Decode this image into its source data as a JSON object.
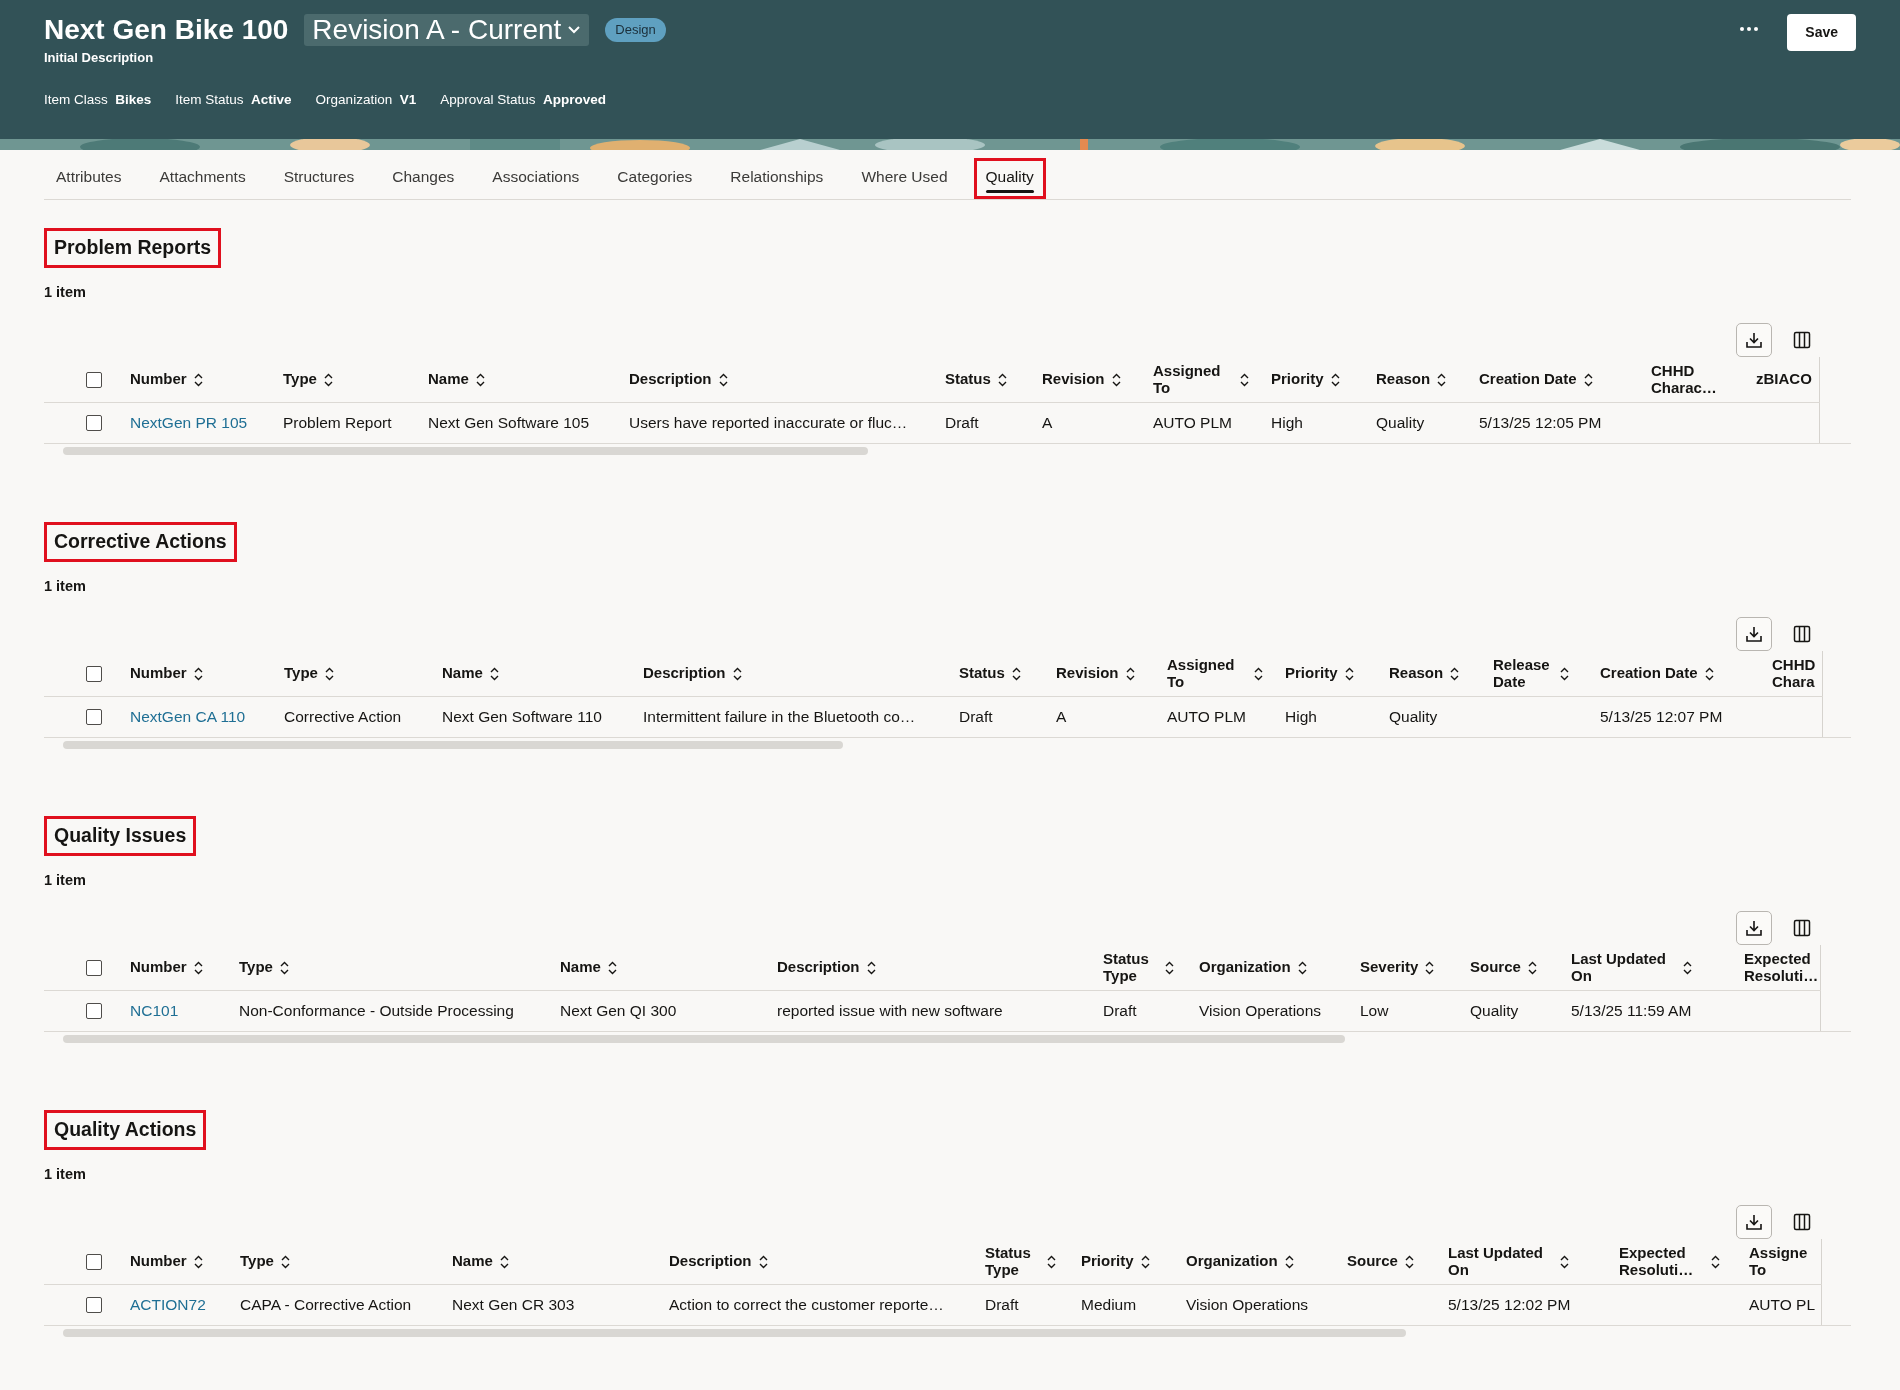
{
  "header": {
    "title": "Next Gen Bike 100",
    "revision": "Revision A - Current",
    "badge": "Design",
    "description": "Initial Description",
    "meta": [
      {
        "label": "Item Class",
        "value": "Bikes"
      },
      {
        "label": "Item Status",
        "value": "Active"
      },
      {
        "label": "Organization",
        "value": "V1"
      },
      {
        "label": "Approval Status",
        "value": "Approved"
      }
    ],
    "save": "Save"
  },
  "tabs": [
    {
      "label": "Attributes",
      "selected": false,
      "highlighted": false
    },
    {
      "label": "Attachments",
      "selected": false,
      "highlighted": false
    },
    {
      "label": "Structures",
      "selected": false,
      "highlighted": false
    },
    {
      "label": "Changes",
      "selected": false,
      "highlighted": false
    },
    {
      "label": "Associations",
      "selected": false,
      "highlighted": false
    },
    {
      "label": "Categories",
      "selected": false,
      "highlighted": false
    },
    {
      "label": "Relationships",
      "selected": false,
      "highlighted": false
    },
    {
      "label": "Where Used",
      "selected": false,
      "highlighted": false
    },
    {
      "label": "Quality",
      "selected": true,
      "highlighted": true
    }
  ],
  "sections": [
    {
      "title": "Problem Reports",
      "highlighted": true,
      "count": "1 item",
      "all_checked": false,
      "columns": [
        {
          "label": "Number",
          "sortable": true
        },
        {
          "label": "Type",
          "sortable": true
        },
        {
          "label": "Name",
          "sortable": true
        },
        {
          "label": "Description",
          "sortable": true
        },
        {
          "label": "Status",
          "sortable": true
        },
        {
          "label": "Revision",
          "sortable": true
        },
        {
          "label": "Assigned To",
          "sortable": true
        },
        {
          "label": "Priority",
          "sortable": true
        },
        {
          "label": "Reason",
          "sortable": true
        },
        {
          "label": "Creation Date",
          "sortable": true
        },
        {
          "label": "CHHD Charac…",
          "sortable": false
        },
        {
          "label": "zBIACO",
          "sortable": false
        }
      ],
      "rows": [
        {
          "checked": false,
          "cells": [
            "NextGen PR 105",
            "Problem Report",
            "Next Gen Software 105",
            "Users have reported inaccurate or fluc…",
            "Draft",
            "A",
            "AUTO PLM",
            "High",
            "Quality",
            "5/13/25 12:05 PM",
            "",
            ""
          ]
        }
      ]
    },
    {
      "title": "Corrective Actions",
      "highlighted": true,
      "count": "1 item",
      "all_checked": false,
      "columns": [
        {
          "label": "Number",
          "sortable": true
        },
        {
          "label": "Type",
          "sortable": true
        },
        {
          "label": "Name",
          "sortable": true
        },
        {
          "label": "Description",
          "sortable": true
        },
        {
          "label": "Status",
          "sortable": true
        },
        {
          "label": "Revision",
          "sortable": true
        },
        {
          "label": "Assigned To",
          "sortable": true
        },
        {
          "label": "Priority",
          "sortable": true
        },
        {
          "label": "Reason",
          "sortable": true
        },
        {
          "label": "Release Date",
          "sortable": true
        },
        {
          "label": "Creation Date",
          "sortable": true
        },
        {
          "label": "CHHD Chara",
          "sortable": false
        }
      ],
      "rows": [
        {
          "checked": false,
          "cells": [
            "NextGen CA 110",
            "Corrective Action",
            "Next Gen Software 110",
            "Intermittent failure in the Bluetooth co…",
            "Draft",
            "A",
            "AUTO PLM",
            "High",
            "Quality",
            "",
            "5/13/25 12:07 PM",
            ""
          ]
        }
      ]
    },
    {
      "title": "Quality Issues",
      "highlighted": true,
      "count": "1 item",
      "all_checked": false,
      "columns": [
        {
          "label": "Number",
          "sortable": true
        },
        {
          "label": "Type",
          "sortable": true
        },
        {
          "label": "Name",
          "sortable": true
        },
        {
          "label": "Description",
          "sortable": true
        },
        {
          "label": "Status Type",
          "sortable": true
        },
        {
          "label": "Organization",
          "sortable": true
        },
        {
          "label": "Severity",
          "sortable": true
        },
        {
          "label": "Source",
          "sortable": true
        },
        {
          "label": "Last Updated On",
          "sortable": true
        },
        {
          "label": "Expected Resoluti…",
          "sortable": false
        }
      ],
      "rows": [
        {
          "checked": false,
          "cells": [
            "NC101",
            "Non-Conformance - Outside Processing",
            "Next Gen QI 300",
            "reported issue with new software",
            "Draft",
            "Vision Operations",
            "Low",
            "Quality",
            "5/13/25 11:59 AM",
            ""
          ]
        }
      ]
    },
    {
      "title": "Quality Actions",
      "highlighted": true,
      "count": "1 item",
      "all_checked": false,
      "columns": [
        {
          "label": "Number",
          "sortable": true
        },
        {
          "label": "Type",
          "sortable": true
        },
        {
          "label": "Name",
          "sortable": true
        },
        {
          "label": "Description",
          "sortable": true
        },
        {
          "label": "Status Type",
          "sortable": true
        },
        {
          "label": "Priority",
          "sortable": true
        },
        {
          "label": "Organization",
          "sortable": true
        },
        {
          "label": "Source",
          "sortable": true
        },
        {
          "label": "Last Updated On",
          "sortable": true
        },
        {
          "label": "Expected Resoluti…",
          "sortable": true
        },
        {
          "label": "Assigne To",
          "sortable": false
        }
      ],
      "rows": [
        {
          "checked": false,
          "cells": [
            "ACTION72",
            "CAPA - Corrective Action",
            "Next Gen CR 303",
            "Action to correct the customer reporte…",
            "Draft",
            "Medium",
            "Vision Operations",
            "",
            "5/13/25 12:02 PM",
            "",
            "AUTO PL"
          ]
        }
      ]
    }
  ]
}
